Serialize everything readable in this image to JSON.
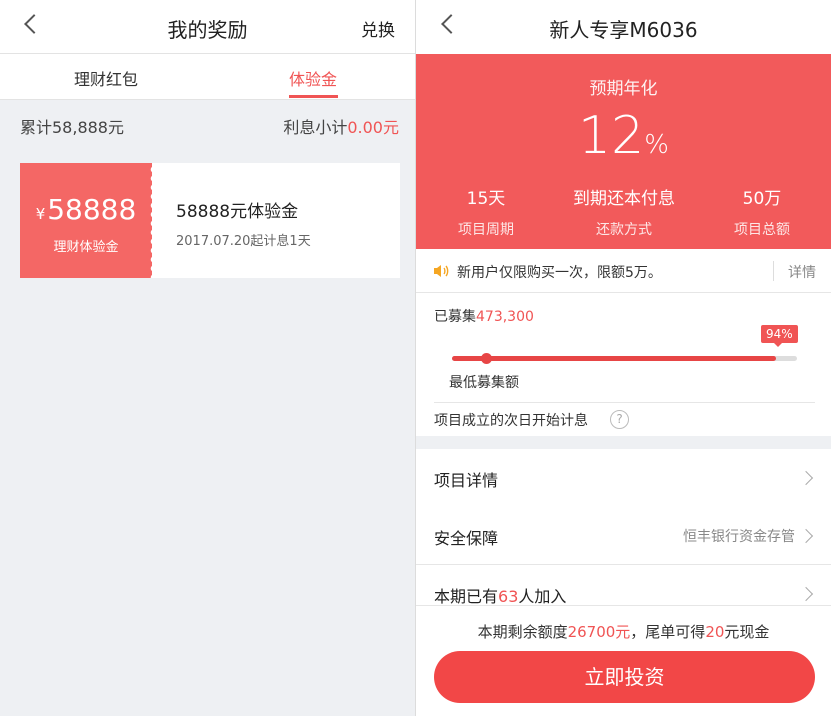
{
  "left": {
    "title": "我的奖励",
    "nav_right": "兑换",
    "tabs": [
      "理财红包",
      "体验金"
    ],
    "active_tab": 1,
    "summary_left_label": "累计58,888元",
    "summary_right_label": "利息小计",
    "summary_right_value": "0.00元",
    "coupon": {
      "currency": "¥",
      "amount": "58888",
      "type": "理财体验金",
      "title": "58888元体验金",
      "desc": "2017.07.20起计息1天"
    }
  },
  "right": {
    "title": "新人专享M6036",
    "hero": {
      "label": "预期年化",
      "rate": "12",
      "rate_unit": "%",
      "stats": [
        {
          "value": "15天",
          "label": "项目周期"
        },
        {
          "value": "到期还本付息",
          "label": "还款方式"
        },
        {
          "value": "50万",
          "label": "项目总额"
        }
      ]
    },
    "notice": {
      "text": "新用户仅限购买一次，限额5万。",
      "more": "详情"
    },
    "raise": {
      "label": "已募集",
      "amount": "473,300",
      "percent_label": "94%",
      "progress": 0.94,
      "min_label": "最低募集额",
      "info": "项目成立的次日开始计息",
      "help_icon": "?"
    },
    "rows": [
      {
        "key": "项目详情",
        "value": ""
      },
      {
        "key": "安全保障",
        "value": "恒丰银行资金存管"
      },
      {
        "key_prefix": "本期已有",
        "key_count": "63",
        "key_suffix": "人加入"
      }
    ],
    "bottom": {
      "note_prefix": "本期剩余额度",
      "note_amount": "26700元",
      "note_mid": "，尾单可得",
      "note_cash": "20",
      "note_suffix": "元现金",
      "button": "立即投资"
    }
  },
  "colors": {
    "accent": "#f25a5b",
    "button": "#f24747",
    "background": "#eef0f3"
  }
}
